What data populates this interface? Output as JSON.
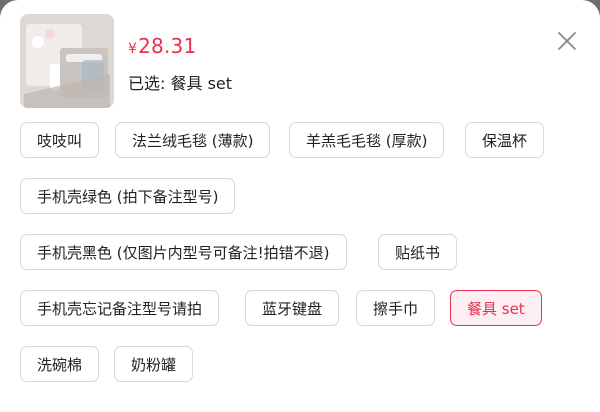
{
  "product": {
    "price_currency": "¥",
    "price_value": "28.31",
    "selected_text": "已选: 餐具 set",
    "thumbnail_icon": "product-photo"
  },
  "close_icon": "close-icon",
  "colors": {
    "accent": "#e8314e",
    "accent_bg": "#fdeef1",
    "chip_border": "#d8d8d8"
  },
  "options": [
    {
      "label": "吱吱叫",
      "selected": false
    },
    {
      "label": "法兰绒毛毯 (薄款)",
      "selected": false
    },
    {
      "label": "羊羔毛毛毯 (厚款)",
      "selected": false
    },
    {
      "label": "保温杯",
      "selected": false
    },
    {
      "label": "手机壳绿色 (拍下备注型号)",
      "selected": false
    },
    {
      "label": "手机壳黑色 (仅图片内型号可备注!拍错不退)",
      "selected": false
    },
    {
      "label": "贴纸书",
      "selected": false
    },
    {
      "label": "手机壳忘记备注型号请拍",
      "selected": false
    },
    {
      "label": "蓝牙键盘",
      "selected": false
    },
    {
      "label": "擦手巾",
      "selected": false
    },
    {
      "label": "餐具 set",
      "selected": true
    },
    {
      "label": "洗碗棉",
      "selected": false
    },
    {
      "label": "奶粉罐",
      "selected": false
    }
  ]
}
